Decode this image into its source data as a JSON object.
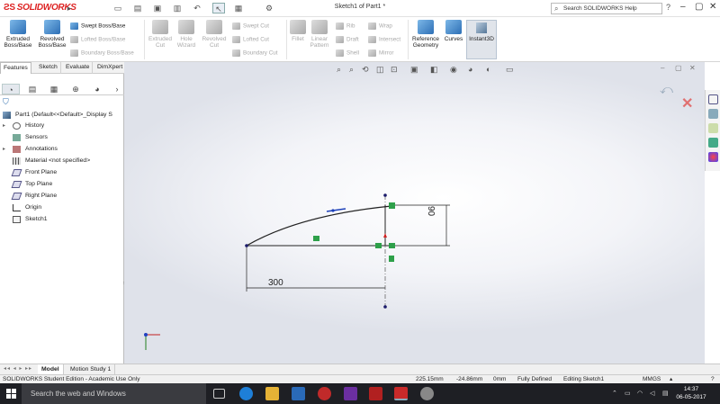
{
  "app": {
    "logo_text": "SOLIDWORKS",
    "document_title": "Sketch1 of Part1 *",
    "search_placeholder": "Search SOLIDWORKS Help"
  },
  "ribbon": {
    "extruded_boss_base": "Extruded Boss/Base",
    "revolved_boss_base": "Revolved Boss/Base",
    "swept_boss_base": "Swept Boss/Base",
    "lofted_boss_base": "Lofted Boss/Base",
    "boundary_boss_base": "Boundary Boss/Base",
    "extruded_cut": "Extruded Cut",
    "hole_wizard": "Hole Wizard",
    "revolved_cut": "Revolved Cut",
    "swept_cut": "Swept Cut",
    "lofted_cut": "Lofted Cut",
    "boundary_cut": "Boundary Cut",
    "fillet": "Fillet",
    "linear_pattern": "Linear Pattern",
    "rib": "Rib",
    "draft": "Draft",
    "shell": "Shell",
    "wrap": "Wrap",
    "intersect": "Intersect",
    "mirror": "Mirror",
    "reference_geometry": "Reference Geometry",
    "curves": "Curves",
    "instant3d": "Instant3D"
  },
  "command_tabs": [
    "Features",
    "Sketch",
    "Evaluate",
    "DimXpert"
  ],
  "tree": [
    {
      "label": "Part1  (Default<<Default>_Display S",
      "icon": "part-icon",
      "arrow": ""
    },
    {
      "label": "History",
      "icon": "history-icon",
      "arrow": "▸"
    },
    {
      "label": "Sensors",
      "icon": "sensor-icon",
      "arrow": ""
    },
    {
      "label": "Annotations",
      "icon": "annotation-icon",
      "arrow": "▸"
    },
    {
      "label": "Material <not specified>",
      "icon": "material-icon",
      "arrow": ""
    },
    {
      "label": "Front Plane",
      "icon": "plane-icon",
      "arrow": ""
    },
    {
      "label": "Top Plane",
      "icon": "plane-icon",
      "arrow": ""
    },
    {
      "label": "Right Plane",
      "icon": "plane-icon",
      "arrow": ""
    },
    {
      "label": "Origin",
      "icon": "origin-icon",
      "arrow": ""
    },
    {
      "label": "Sketch1",
      "icon": "sketch-icon",
      "arrow": ""
    }
  ],
  "sketch": {
    "dim_horizontal": "300",
    "dim_vertical": "90"
  },
  "bottom_tabs": [
    "Model",
    "Motion Study 1"
  ],
  "status": {
    "edition": "SOLIDWORKS Student Edition - Academic Use Only",
    "x": "225.15mm",
    "y": "-24.86mm",
    "z": "0mm",
    "state": "Fully Defined",
    "editing": "Editing Sketch1",
    "units": "MMGS"
  },
  "taskbar": {
    "search_text": "Search the web and Windows",
    "time": "14:37",
    "date": "06-05-2017"
  }
}
